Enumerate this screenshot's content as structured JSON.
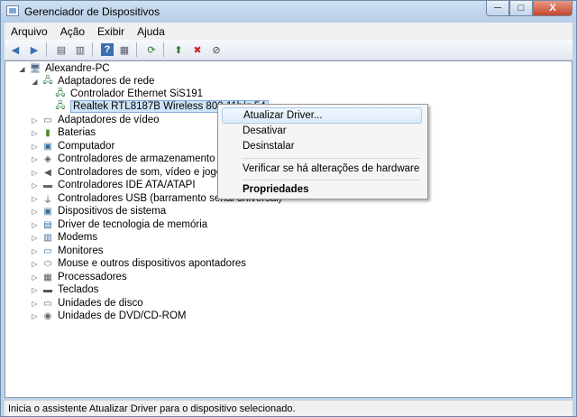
{
  "window": {
    "title": "Gerenciador de Dispositivos",
    "minimize_label": "─",
    "maximize_label": "□",
    "close_label": "X"
  },
  "menu": [
    "Arquivo",
    "Ação",
    "Exibir",
    "Ajuda"
  ],
  "toolbar": {
    "back_icon": "◀",
    "forward_icon": "▶",
    "view1_icon": "▤",
    "view2_icon": "▥",
    "help_icon": "?",
    "view3_icon": "▦",
    "scan_icon": "⟳",
    "update_icon": "⬆",
    "uninstall_icon": "✖",
    "disable_icon": "⊘"
  },
  "tree": {
    "root": "Alexandre-PC",
    "items": [
      {
        "label": "Adaptadores de rede",
        "expanded": true
      },
      {
        "label": "Controlador Ethernet SiS191",
        "child": true
      },
      {
        "label": "Realtek RTL8187B Wireless 802.11b/g 54",
        "child": true,
        "selected": true
      },
      {
        "label": "Adaptadores de vídeo"
      },
      {
        "label": "Baterias"
      },
      {
        "label": "Computador"
      },
      {
        "label": "Controladores de armazenamento"
      },
      {
        "label": "Controladores de som, vídeo e jogos"
      },
      {
        "label": "Controladores IDE ATA/ATAPI"
      },
      {
        "label": "Controladores USB (barramento serial universal)"
      },
      {
        "label": "Dispositivos de sistema"
      },
      {
        "label": "Driver de tecnologia de memória"
      },
      {
        "label": "Modems"
      },
      {
        "label": "Monitores"
      },
      {
        "label": "Mouse e outros dispositivos apontadores"
      },
      {
        "label": "Processadores"
      },
      {
        "label": "Teclados"
      },
      {
        "label": "Unidades de disco"
      },
      {
        "label": "Unidades de DVD/CD-ROM"
      }
    ]
  },
  "context_menu": {
    "update": "Atualizar Driver...",
    "disable": "Desativar",
    "uninstall": "Desinstalar",
    "scan": "Verificar se há alterações de hardware",
    "properties": "Propriedades"
  },
  "status": "Inicia o assistente Atualizar Driver para o dispositivo selecionado."
}
